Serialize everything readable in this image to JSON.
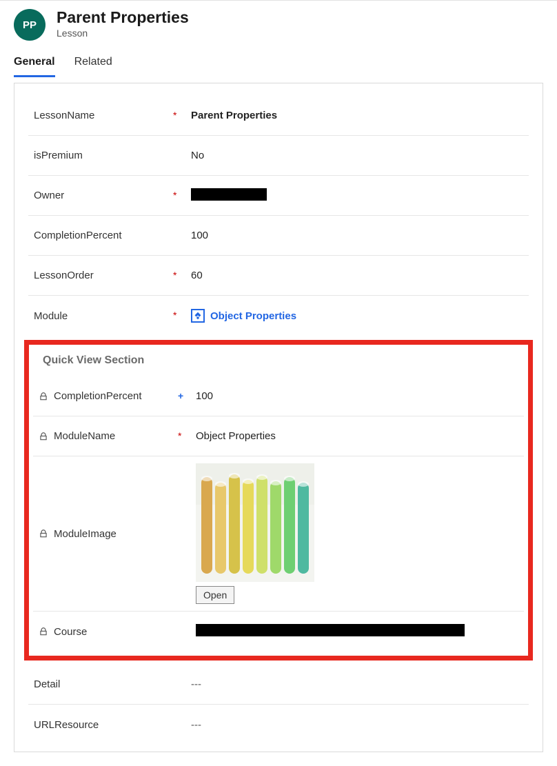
{
  "header": {
    "avatar_initials": "PP",
    "title": "Parent Properties",
    "subtitle": "Lesson"
  },
  "tabs": [
    {
      "label": "General",
      "active": true
    },
    {
      "label": "Related",
      "active": false
    }
  ],
  "fields": {
    "lessonName": {
      "label": "LessonName",
      "value": "Parent Properties",
      "required": true
    },
    "isPremium": {
      "label": "isPremium",
      "value": "No",
      "required": false
    },
    "owner": {
      "label": "Owner",
      "value_redacted": true,
      "required": true
    },
    "completionPercent": {
      "label": "CompletionPercent",
      "value": "100",
      "required": false
    },
    "lessonOrder": {
      "label": "LessonOrder",
      "value": "60",
      "required": true
    },
    "module": {
      "label": "Module",
      "lookup_text": "Object Properties",
      "required": true
    }
  },
  "quickView": {
    "section_title": "Quick View Section",
    "completionPercent": {
      "label": "CompletionPercent",
      "value": "100",
      "recommended": true
    },
    "moduleName": {
      "label": "ModuleName",
      "value": "Object Properties",
      "required": true
    },
    "moduleImage": {
      "label": "ModuleImage",
      "open_label": "Open"
    },
    "course": {
      "label": "Course",
      "value_redacted": true
    }
  },
  "tail": {
    "detail": {
      "label": "Detail",
      "value": "---"
    },
    "urlResource": {
      "label": "URLResource",
      "value": "---"
    }
  }
}
